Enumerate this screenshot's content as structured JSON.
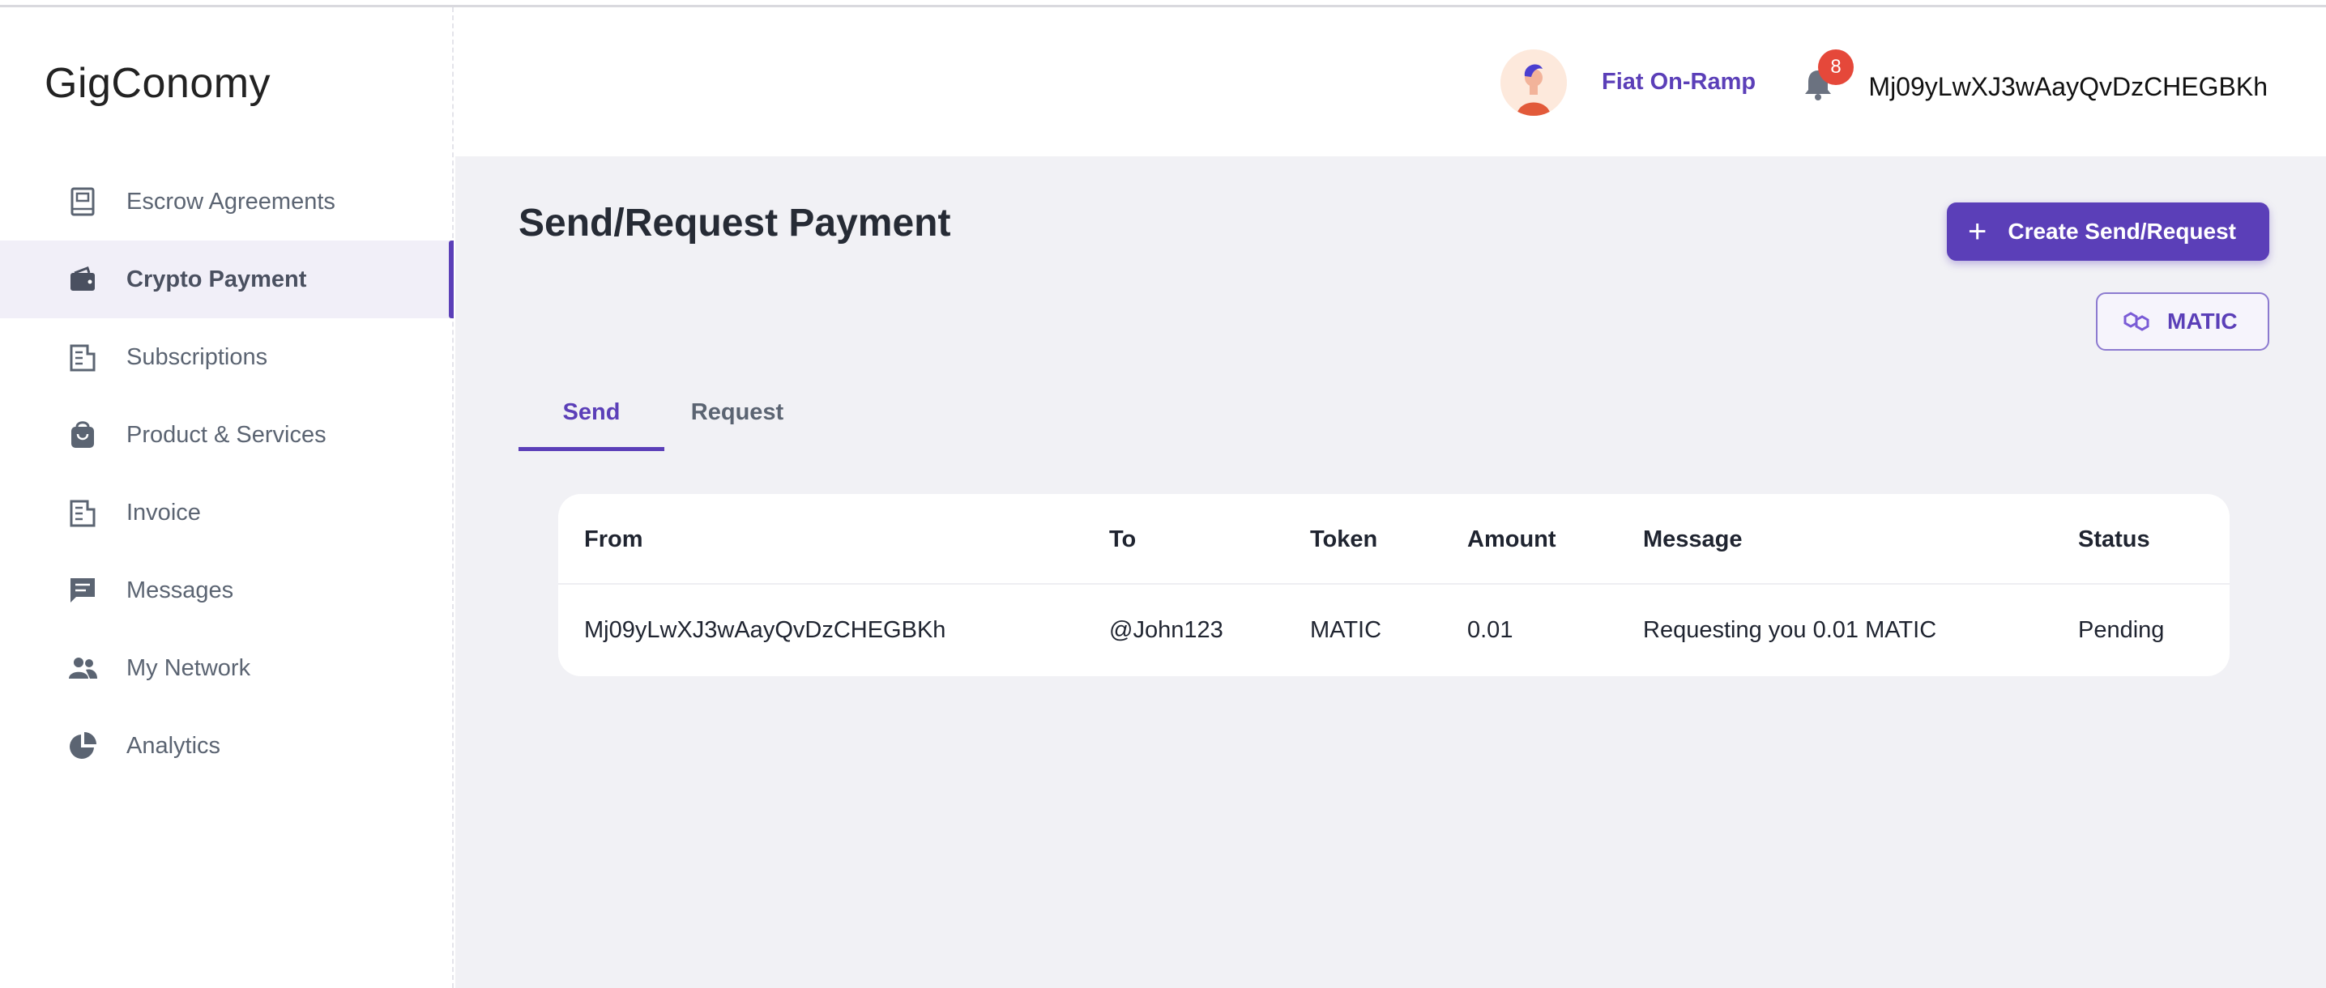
{
  "app": {
    "logo": "GigConomy"
  },
  "sidebar": {
    "items": [
      {
        "label": "Escrow Agreements",
        "icon": "book-icon",
        "active": false
      },
      {
        "label": "Crypto Payment",
        "icon": "wallet-icon",
        "active": true
      },
      {
        "label": "Subscriptions",
        "icon": "receipt-icon",
        "active": false
      },
      {
        "label": "Product & Services",
        "icon": "shopping-bag-icon",
        "active": false
      },
      {
        "label": "Invoice",
        "icon": "invoice-icon",
        "active": false
      },
      {
        "label": "Messages",
        "icon": "message-icon",
        "active": false
      },
      {
        "label": "My Network",
        "icon": "people-icon",
        "active": false
      },
      {
        "label": "Analytics",
        "icon": "pie-chart-icon",
        "active": false
      }
    ]
  },
  "header": {
    "fiat_label": "Fiat On-Ramp",
    "notification_count": "8",
    "wallet_address": "Mj09yLwXJ3wAayQvDzCHEGBKh"
  },
  "main": {
    "title": "Send/Request Payment",
    "create_button": "Create Send/Request",
    "token_button": "MATIC",
    "tabs": [
      {
        "label": "Send",
        "active": true
      },
      {
        "label": "Request",
        "active": false
      }
    ],
    "table": {
      "columns": [
        "From",
        "To",
        "Token",
        "Amount",
        "Message",
        "Status"
      ],
      "rows": [
        [
          "Mj09yLwXJ3wAayQvDzCHEGBKh",
          "@John123",
          "MATIC",
          "0.01",
          "Requesting you 0.01 MATIC",
          "Pending"
        ]
      ]
    }
  },
  "colors": {
    "accent": "#5b3fb8",
    "badge": "#e5483a",
    "content_bg": "#f1f1f5"
  }
}
